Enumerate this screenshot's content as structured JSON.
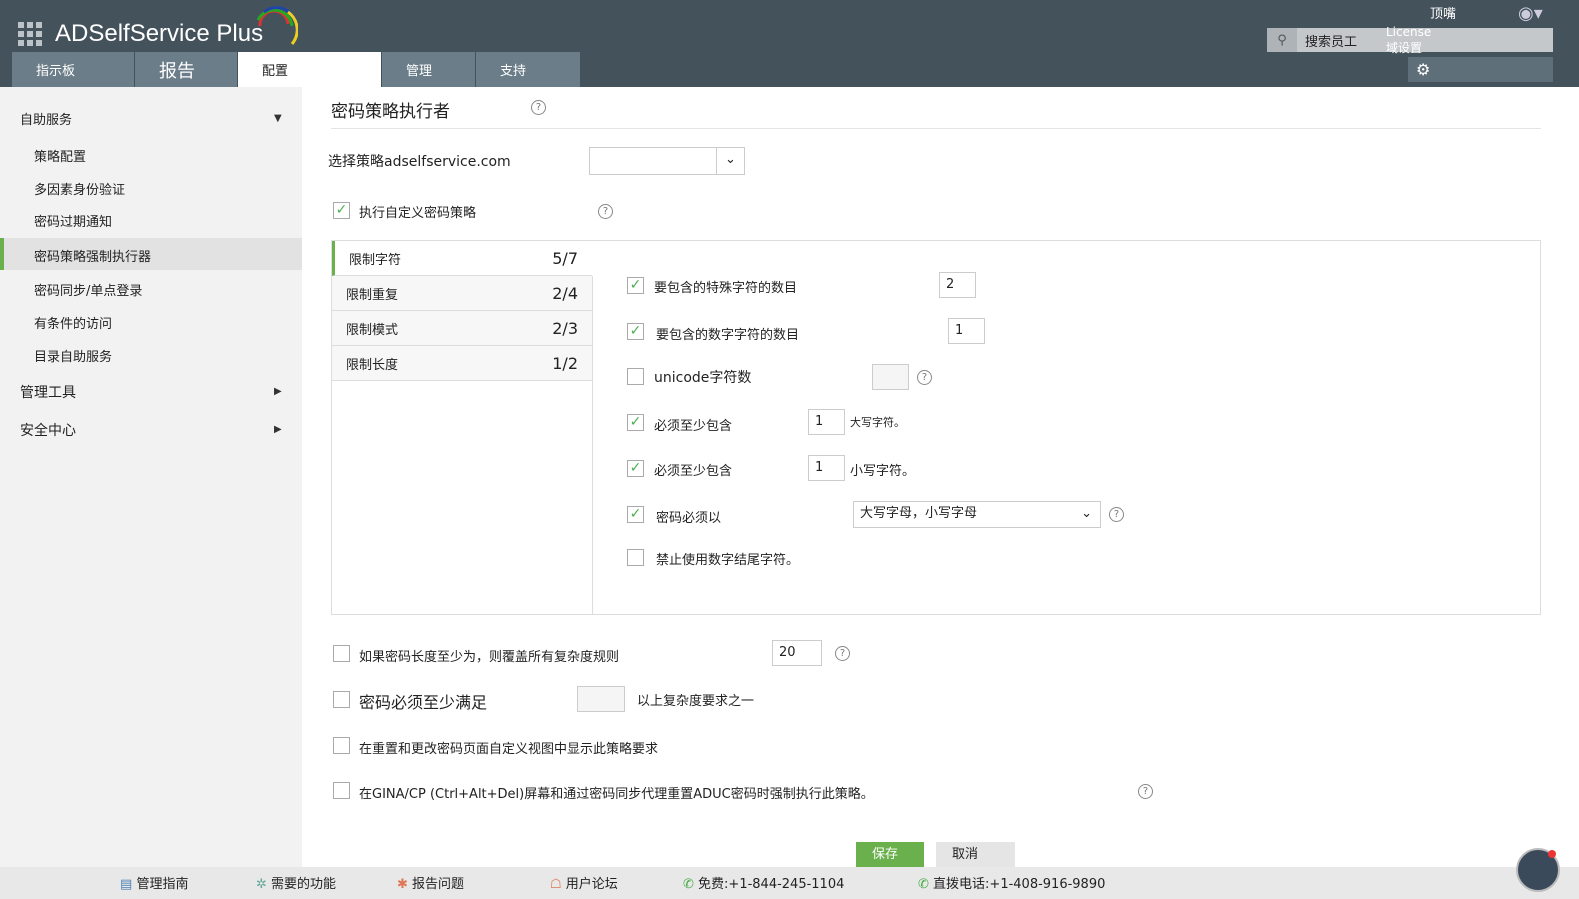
{
  "header": {
    "brand": "ADSelfService Plus",
    "tabs": [
      "指示板",
      "报告",
      "配置",
      "管理",
      "支持"
    ],
    "top_label": "顶嘴",
    "search_placeholder": "搜索员工",
    "license": "License",
    "domain_settings": "域设置"
  },
  "sidebar": {
    "self_service": "自助服务",
    "items": [
      "策略配置",
      "多因素身份验证",
      "密码过期通知",
      "密码策略强制执行器",
      "密码同步/单点登录",
      "有条件的访问",
      "目录自助服务"
    ],
    "admin_tools": "管理工具",
    "security_center": "安全中心"
  },
  "main": {
    "title": "密码策略执行者",
    "select_policy_label": "选择策略adselfservice.com",
    "enforce_custom": "执行自定义密码策略",
    "rule_tabs": [
      {
        "label": "限制字符",
        "count": "5/7"
      },
      {
        "label": "限制重复",
        "count": "2/4"
      },
      {
        "label": "限制模式",
        "count": "2/3"
      },
      {
        "label": "限制长度",
        "count": "1/2"
      }
    ],
    "rules": {
      "special": {
        "label": "要包含的特殊字符的数目",
        "value": "2",
        "checked": true
      },
      "numeric": {
        "label": "要包含的数字字符的数目",
        "value": "1",
        "checked": true
      },
      "unicode": {
        "label": "unicode字符数",
        "value": "",
        "checked": false
      },
      "upper": {
        "label": "必须至少包含",
        "value": "1",
        "suffix": "大写字符。",
        "checked": true
      },
      "lower": {
        "label": "必须至少包含",
        "value": "1",
        "suffix": "小写字符。",
        "checked": true
      },
      "start": {
        "label": "密码必须以",
        "value": "大写字母，小写字母",
        "checked": true
      },
      "no_num_end": {
        "label": "禁止使用数字结尾字符。",
        "checked": false
      }
    },
    "override": {
      "label": "如果密码长度至少为，则覆盖所有复杂度规则",
      "value": "20"
    },
    "min_meet": {
      "label": "密码必须至少满足",
      "suffix": "以上复杂度要求之一"
    },
    "show_policy": "在重置和更改密码页面自定义视图中显示此策略要求",
    "gina": "在GINA/CP (Ctrl+Alt+Del)屏幕和通过密码同步代理重置ADUC密码时强制执行此策略。",
    "save": "保存",
    "cancel": "取消"
  },
  "footer": [
    "管理指南",
    "需要的功能",
    "报告问题",
    "用户论坛",
    "免费:+1-844-245-1104",
    "直拨电话:+1-408-916-9890"
  ],
  "colors": {
    "header": "#44525c",
    "accent": "#6ab04c"
  }
}
